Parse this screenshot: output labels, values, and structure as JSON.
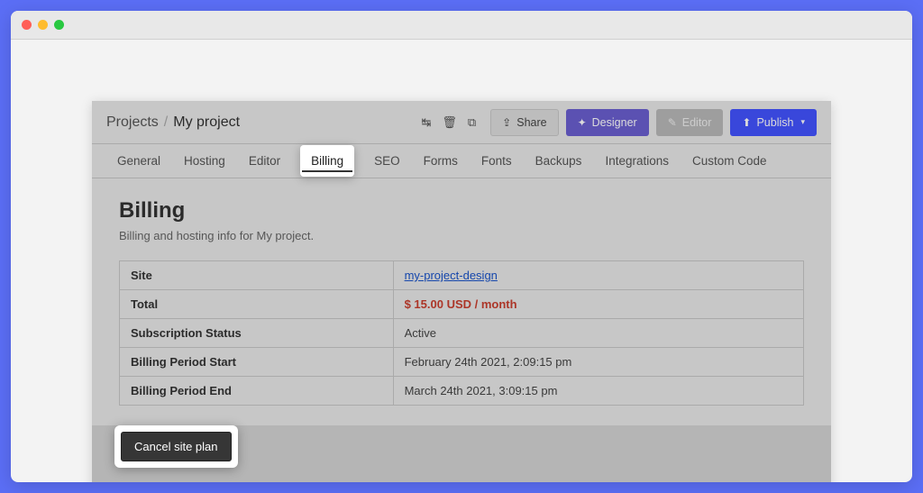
{
  "breadcrumb": {
    "root": "Projects",
    "current": "My project"
  },
  "header": {
    "share": "Share",
    "designer": "Designer",
    "editor": "Editor",
    "publish": "Publish"
  },
  "tabs": {
    "general": "General",
    "hosting": "Hosting",
    "editor": "Editor",
    "billing": "Billing",
    "seo": "SEO",
    "forms": "Forms",
    "fonts": "Fonts",
    "backups": "Backups",
    "integrations": "Integrations",
    "custom_code": "Custom Code"
  },
  "billing": {
    "title": "Billing",
    "subtitle": "Billing and hosting info for My project.",
    "rows": {
      "site_label": "Site",
      "site_value": "my-project-design",
      "total_label": "Total",
      "total_value": "$ 15.00 USD / month",
      "status_label": "Subscription Status",
      "status_value": "Active",
      "start_label": "Billing Period Start",
      "start_value": "February 24th 2021, 2:09:15 pm",
      "end_label": "Billing Period End",
      "end_value": "March 24th 2021, 3:09:15 pm"
    },
    "cancel_button": "Cancel site plan"
  }
}
